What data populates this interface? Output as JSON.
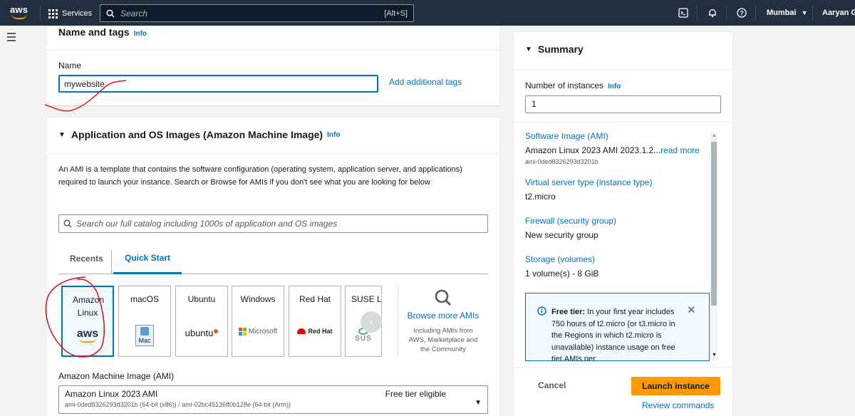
{
  "nav": {
    "logo": "aws",
    "services": "Services",
    "search_placeholder": "Search",
    "search_shortcut": "[Alt+S]",
    "region": "Mumbai",
    "user": "Aaryan Gu"
  },
  "name_tags": {
    "title": "Name and tags",
    "info": "Info",
    "name_label": "Name",
    "name_value": "mywebsite",
    "add_tags": "Add additional tags"
  },
  "ami_section": {
    "title": "Application and OS Images (Amazon Machine Image)",
    "info": "Info",
    "description": "An AMI is a template that contains the software configuration (operating system, application server, and applications) required to launch your instance. Search or Browse for AMIs if you don't see what you are looking for below",
    "search_placeholder": "Search our full catalog including 1000s of application and OS images",
    "tabs": [
      "Recents",
      "Quick Start"
    ],
    "cards": [
      {
        "label": "Amazon Linux",
        "logo": "aws"
      },
      {
        "label": "macOS",
        "logo": "Mac"
      },
      {
        "label": "Ubuntu",
        "logo": "ubuntu"
      },
      {
        "label": "Windows",
        "logo": "Microsoft"
      },
      {
        "label": "Red Hat",
        "logo": "Red Hat"
      },
      {
        "label": "SUSE L",
        "logo": "SUS"
      }
    ],
    "browse_label": "Browse more AMIs",
    "browse_desc": "Including AMIs from AWS, Marketplace and the Community",
    "ami_label": "Amazon Machine Image (AMI)",
    "ami_name": "Amazon Linux 2023 AMI",
    "ami_eligibility": "Free tier eligible",
    "ami_ids": "ami-0ded8326293d3201b (64-bit (x86)) / ami-02bc45136ff0b128e (64-bit (Arm))"
  },
  "summary": {
    "title": "Summary",
    "instances_label": "Number of instances",
    "info": "Info",
    "instances_value": "1",
    "software_image_label": "Software Image (AMI)",
    "software_image_value": "Amazon Linux 2023 AMI 2023.1.2...",
    "read_more": "read more",
    "ami_id": "ami-0ded8326293d3201b",
    "instance_type_label": "Virtual server type (instance type)",
    "instance_type_value": "t2.micro",
    "firewall_label": "Firewall (security group)",
    "firewall_value": "New security group",
    "storage_label": "Storage (volumes)",
    "storage_value": "1 volume(s) - 8 GiB",
    "free_tier_title": "Free tier:",
    "free_tier_text": "In your first year includes 750 hours of t2.micro (or t3.micro in the Regions in which t2.micro is unavailable) instance usage on free tier AMIs per",
    "cancel": "Cancel",
    "launch": "Launch instance",
    "review": "Review commands"
  },
  "colors": {
    "nav_bg": "#232f3e",
    "link": "#0073bb",
    "launch_button": "#ff9900",
    "annotation": "#e0141c"
  }
}
